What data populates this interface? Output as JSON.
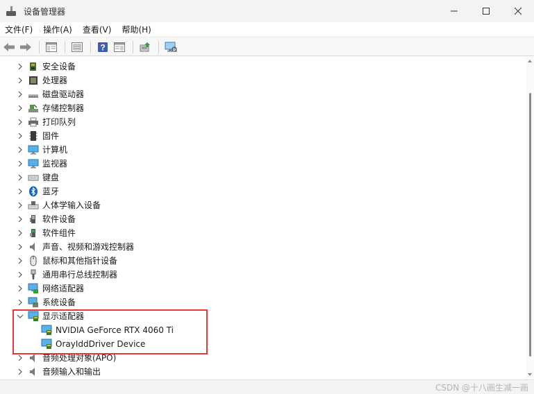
{
  "window": {
    "title": "设备管理器",
    "minimize_icon": "minimize-icon",
    "maximize_icon": "maximize-icon",
    "close_icon": "close-icon"
  },
  "menu": [
    {
      "label": "文件(F)"
    },
    {
      "label": "操作(A)"
    },
    {
      "label": "查看(V)"
    },
    {
      "label": "帮助(H)"
    }
  ],
  "toolbar": [
    {
      "icon": "back-arrow-icon"
    },
    {
      "icon": "forward-arrow-icon"
    },
    {
      "icon": "properties-pane-icon"
    },
    {
      "icon": "device-list-icon"
    },
    {
      "icon": "help-icon"
    },
    {
      "icon": "console-icon"
    },
    {
      "icon": "update-driver-icon"
    },
    {
      "icon": "monitor-scan-icon"
    }
  ],
  "tree": [
    {
      "label": "安全设备",
      "icon": "security-device-icon",
      "expanded": false
    },
    {
      "label": "处理器",
      "icon": "processor-icon",
      "expanded": false
    },
    {
      "label": "磁盘驱动器",
      "icon": "disk-drive-icon",
      "expanded": false
    },
    {
      "label": "存储控制器",
      "icon": "storage-controller-icon",
      "expanded": false
    },
    {
      "label": "打印队列",
      "icon": "printer-icon",
      "expanded": false
    },
    {
      "label": "固件",
      "icon": "firmware-icon",
      "expanded": false
    },
    {
      "label": "计算机",
      "icon": "computer-icon",
      "expanded": false
    },
    {
      "label": "监视器",
      "icon": "monitor-icon",
      "expanded": false
    },
    {
      "label": "键盘",
      "icon": "keyboard-icon",
      "expanded": false
    },
    {
      "label": "蓝牙",
      "icon": "bluetooth-icon",
      "expanded": false
    },
    {
      "label": "人体学输入设备",
      "icon": "hid-icon",
      "expanded": false
    },
    {
      "label": "软件设备",
      "icon": "software-device-icon",
      "expanded": false
    },
    {
      "label": "软件组件",
      "icon": "software-component-icon",
      "expanded": false
    },
    {
      "label": "声音、视频和游戏控制器",
      "icon": "speaker-icon",
      "expanded": false
    },
    {
      "label": "鼠标和其他指针设备",
      "icon": "mouse-icon",
      "expanded": false
    },
    {
      "label": "通用串行总线控制器",
      "icon": "usb-icon",
      "expanded": false
    },
    {
      "label": "网络适配器",
      "icon": "network-adapter-icon",
      "expanded": false
    },
    {
      "label": "系统设备",
      "icon": "system-device-icon",
      "expanded": false
    },
    {
      "label": "显示适配器",
      "icon": "display-adapter-icon",
      "expanded": true
    },
    {
      "label": "NVIDIA GeForce RTX 4060 Ti",
      "icon": "display-adapter-icon",
      "child": true
    },
    {
      "label": "OrayIddDriver Device",
      "icon": "display-adapter-icon",
      "child": true
    },
    {
      "label": "音频处理对象(APO)",
      "icon": "speaker-icon",
      "expanded": false
    },
    {
      "label": "音频输入和输出",
      "icon": "speaker-icon",
      "expanded": false
    }
  ],
  "watermark": "CSDN @十八画生减一画",
  "colors": {
    "highlight_border": "#e53935",
    "titlebar_bg": "#f3f3f3"
  }
}
